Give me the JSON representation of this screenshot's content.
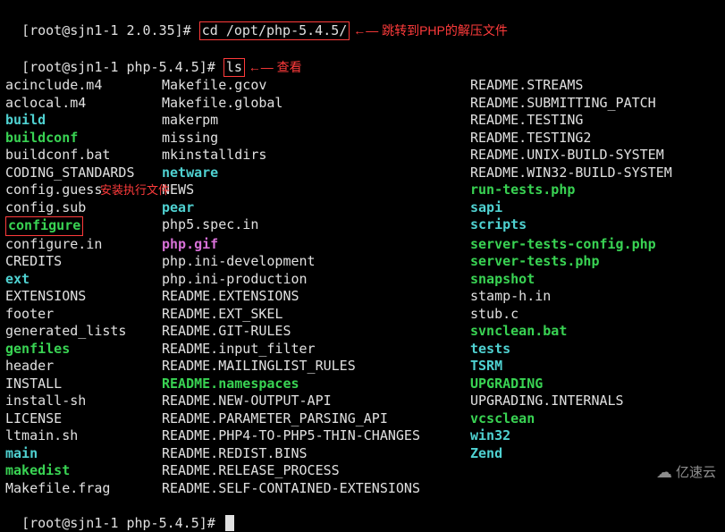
{
  "line1": {
    "prompt": "[root@sjn1-1 2.0.35]# ",
    "cmd": "cd /opt/php-5.4.5/",
    "annot": " ←— 跳转到PHP的解压文件"
  },
  "line2": {
    "prompt": "[root@sjn1-1 php-5.4.5]# ",
    "cmd": "ls",
    "annot": " ←— 查看"
  },
  "annot_configure": "安装执行文件",
  "rows": [
    {
      "c1": {
        "t": "acinclude.m4",
        "cls": "c-white"
      },
      "c2": {
        "t": "Makefile.gcov",
        "cls": "c-white"
      },
      "c3": {
        "t": "README.STREAMS",
        "cls": "c-white"
      }
    },
    {
      "c1": {
        "t": "aclocal.m4",
        "cls": "c-white"
      },
      "c2": {
        "t": "Makefile.global",
        "cls": "c-white"
      },
      "c3": {
        "t": "README.SUBMITTING_PATCH",
        "cls": "c-white"
      }
    },
    {
      "c1": {
        "t": "build",
        "cls": "c-cyan"
      },
      "c2": {
        "t": "makerpm",
        "cls": "c-white"
      },
      "c3": {
        "t": "README.TESTING",
        "cls": "c-white"
      }
    },
    {
      "c1": {
        "t": "buildconf",
        "cls": "c-green"
      },
      "c2": {
        "t": "missing",
        "cls": "c-white"
      },
      "c3": {
        "t": "README.TESTING2",
        "cls": "c-white"
      }
    },
    {
      "c1": {
        "t": "buildconf.bat",
        "cls": "c-white"
      },
      "c2": {
        "t": "mkinstalldirs",
        "cls": "c-white"
      },
      "c3": {
        "t": "README.UNIX-BUILD-SYSTEM",
        "cls": "c-white"
      }
    },
    {
      "c1": {
        "t": "CODING_STANDARDS",
        "cls": "c-white"
      },
      "c2": {
        "t": "netware",
        "cls": "c-cyan"
      },
      "c3": {
        "t": "README.WIN32-BUILD-SYSTEM",
        "cls": "c-white"
      }
    },
    {
      "c1": {
        "t": "config.guess",
        "cls": "c-white"
      },
      "c2": {
        "t": "NEWS",
        "cls": "c-white"
      },
      "c3": {
        "t": "run-tests.php",
        "cls": "c-green"
      }
    },
    {
      "c1": {
        "t": "config.sub",
        "cls": "c-white"
      },
      "c2": {
        "t": "pear",
        "cls": "c-cyan"
      },
      "c3": {
        "t": "sapi",
        "cls": "c-cyan"
      }
    },
    {
      "c1": {
        "t": "configure",
        "cls": "c-green",
        "box": true
      },
      "c2": {
        "t": "php5.spec.in",
        "cls": "c-white"
      },
      "c3": {
        "t": "scripts",
        "cls": "c-cyan"
      }
    },
    {
      "c1": {
        "t": "configure.in",
        "cls": "c-white"
      },
      "c2": {
        "t": "php.gif",
        "cls": "c-magenta"
      },
      "c3": {
        "t": "server-tests-config.php",
        "cls": "c-green"
      }
    },
    {
      "c1": {
        "t": "CREDITS",
        "cls": "c-white"
      },
      "c2": {
        "t": "php.ini-development",
        "cls": "c-white"
      },
      "c3": {
        "t": "server-tests.php",
        "cls": "c-green"
      }
    },
    {
      "c1": {
        "t": "ext",
        "cls": "c-cyan"
      },
      "c2": {
        "t": "php.ini-production",
        "cls": "c-white"
      },
      "c3": {
        "t": "snapshot",
        "cls": "c-green"
      }
    },
    {
      "c1": {
        "t": "EXTENSIONS",
        "cls": "c-white"
      },
      "c2": {
        "t": "README.EXTENSIONS",
        "cls": "c-white"
      },
      "c3": {
        "t": "stamp-h.in",
        "cls": "c-white"
      }
    },
    {
      "c1": {
        "t": "footer",
        "cls": "c-white"
      },
      "c2": {
        "t": "README.EXT_SKEL",
        "cls": "c-white"
      },
      "c3": {
        "t": "stub.c",
        "cls": "c-white"
      }
    },
    {
      "c1": {
        "t": "generated_lists",
        "cls": "c-white"
      },
      "c2": {
        "t": "README.GIT-RULES",
        "cls": "c-white"
      },
      "c3": {
        "t": "svnclean.bat",
        "cls": "c-green"
      }
    },
    {
      "c1": {
        "t": "genfiles",
        "cls": "c-green"
      },
      "c2": {
        "t": "README.input_filter",
        "cls": "c-white"
      },
      "c3": {
        "t": "tests",
        "cls": "c-cyan"
      }
    },
    {
      "c1": {
        "t": "header",
        "cls": "c-white"
      },
      "c2": {
        "t": "README.MAILINGLIST_RULES",
        "cls": "c-white"
      },
      "c3": {
        "t": "TSRM",
        "cls": "c-cyan"
      }
    },
    {
      "c1": {
        "t": "INSTALL",
        "cls": "c-white"
      },
      "c2": {
        "t": "README.namespaces",
        "cls": "c-green"
      },
      "c3": {
        "t": "UPGRADING",
        "cls": "c-green"
      }
    },
    {
      "c1": {
        "t": "install-sh",
        "cls": "c-white"
      },
      "c2": {
        "t": "README.NEW-OUTPUT-API",
        "cls": "c-white"
      },
      "c3": {
        "t": "UPGRADING.INTERNALS",
        "cls": "c-white"
      }
    },
    {
      "c1": {
        "t": "LICENSE",
        "cls": "c-white"
      },
      "c2": {
        "t": "README.PARAMETER_PARSING_API",
        "cls": "c-white"
      },
      "c3": {
        "t": "vcsclean",
        "cls": "c-green"
      }
    },
    {
      "c1": {
        "t": "ltmain.sh",
        "cls": "c-white"
      },
      "c2": {
        "t": "README.PHP4-TO-PHP5-THIN-CHANGES",
        "cls": "c-white"
      },
      "c3": {
        "t": "win32",
        "cls": "c-cyan"
      }
    },
    {
      "c1": {
        "t": "main",
        "cls": "c-cyan"
      },
      "c2": {
        "t": "README.REDIST.BINS",
        "cls": "c-white"
      },
      "c3": {
        "t": "Zend",
        "cls": "c-cyan"
      }
    },
    {
      "c1": {
        "t": "makedist",
        "cls": "c-green"
      },
      "c2": {
        "t": "README.RELEASE_PROCESS",
        "cls": "c-white"
      },
      "c3": {
        "t": "",
        "cls": "c-white"
      }
    },
    {
      "c1": {
        "t": "Makefile.frag",
        "cls": "c-white"
      },
      "c2": {
        "t": "README.SELF-CONTAINED-EXTENSIONS",
        "cls": "c-white"
      },
      "c3": {
        "t": "",
        "cls": "c-white"
      }
    }
  ],
  "line_end": {
    "prompt": "[root@sjn1-1 php-5.4.5]# "
  },
  "watermark": "亿速云"
}
